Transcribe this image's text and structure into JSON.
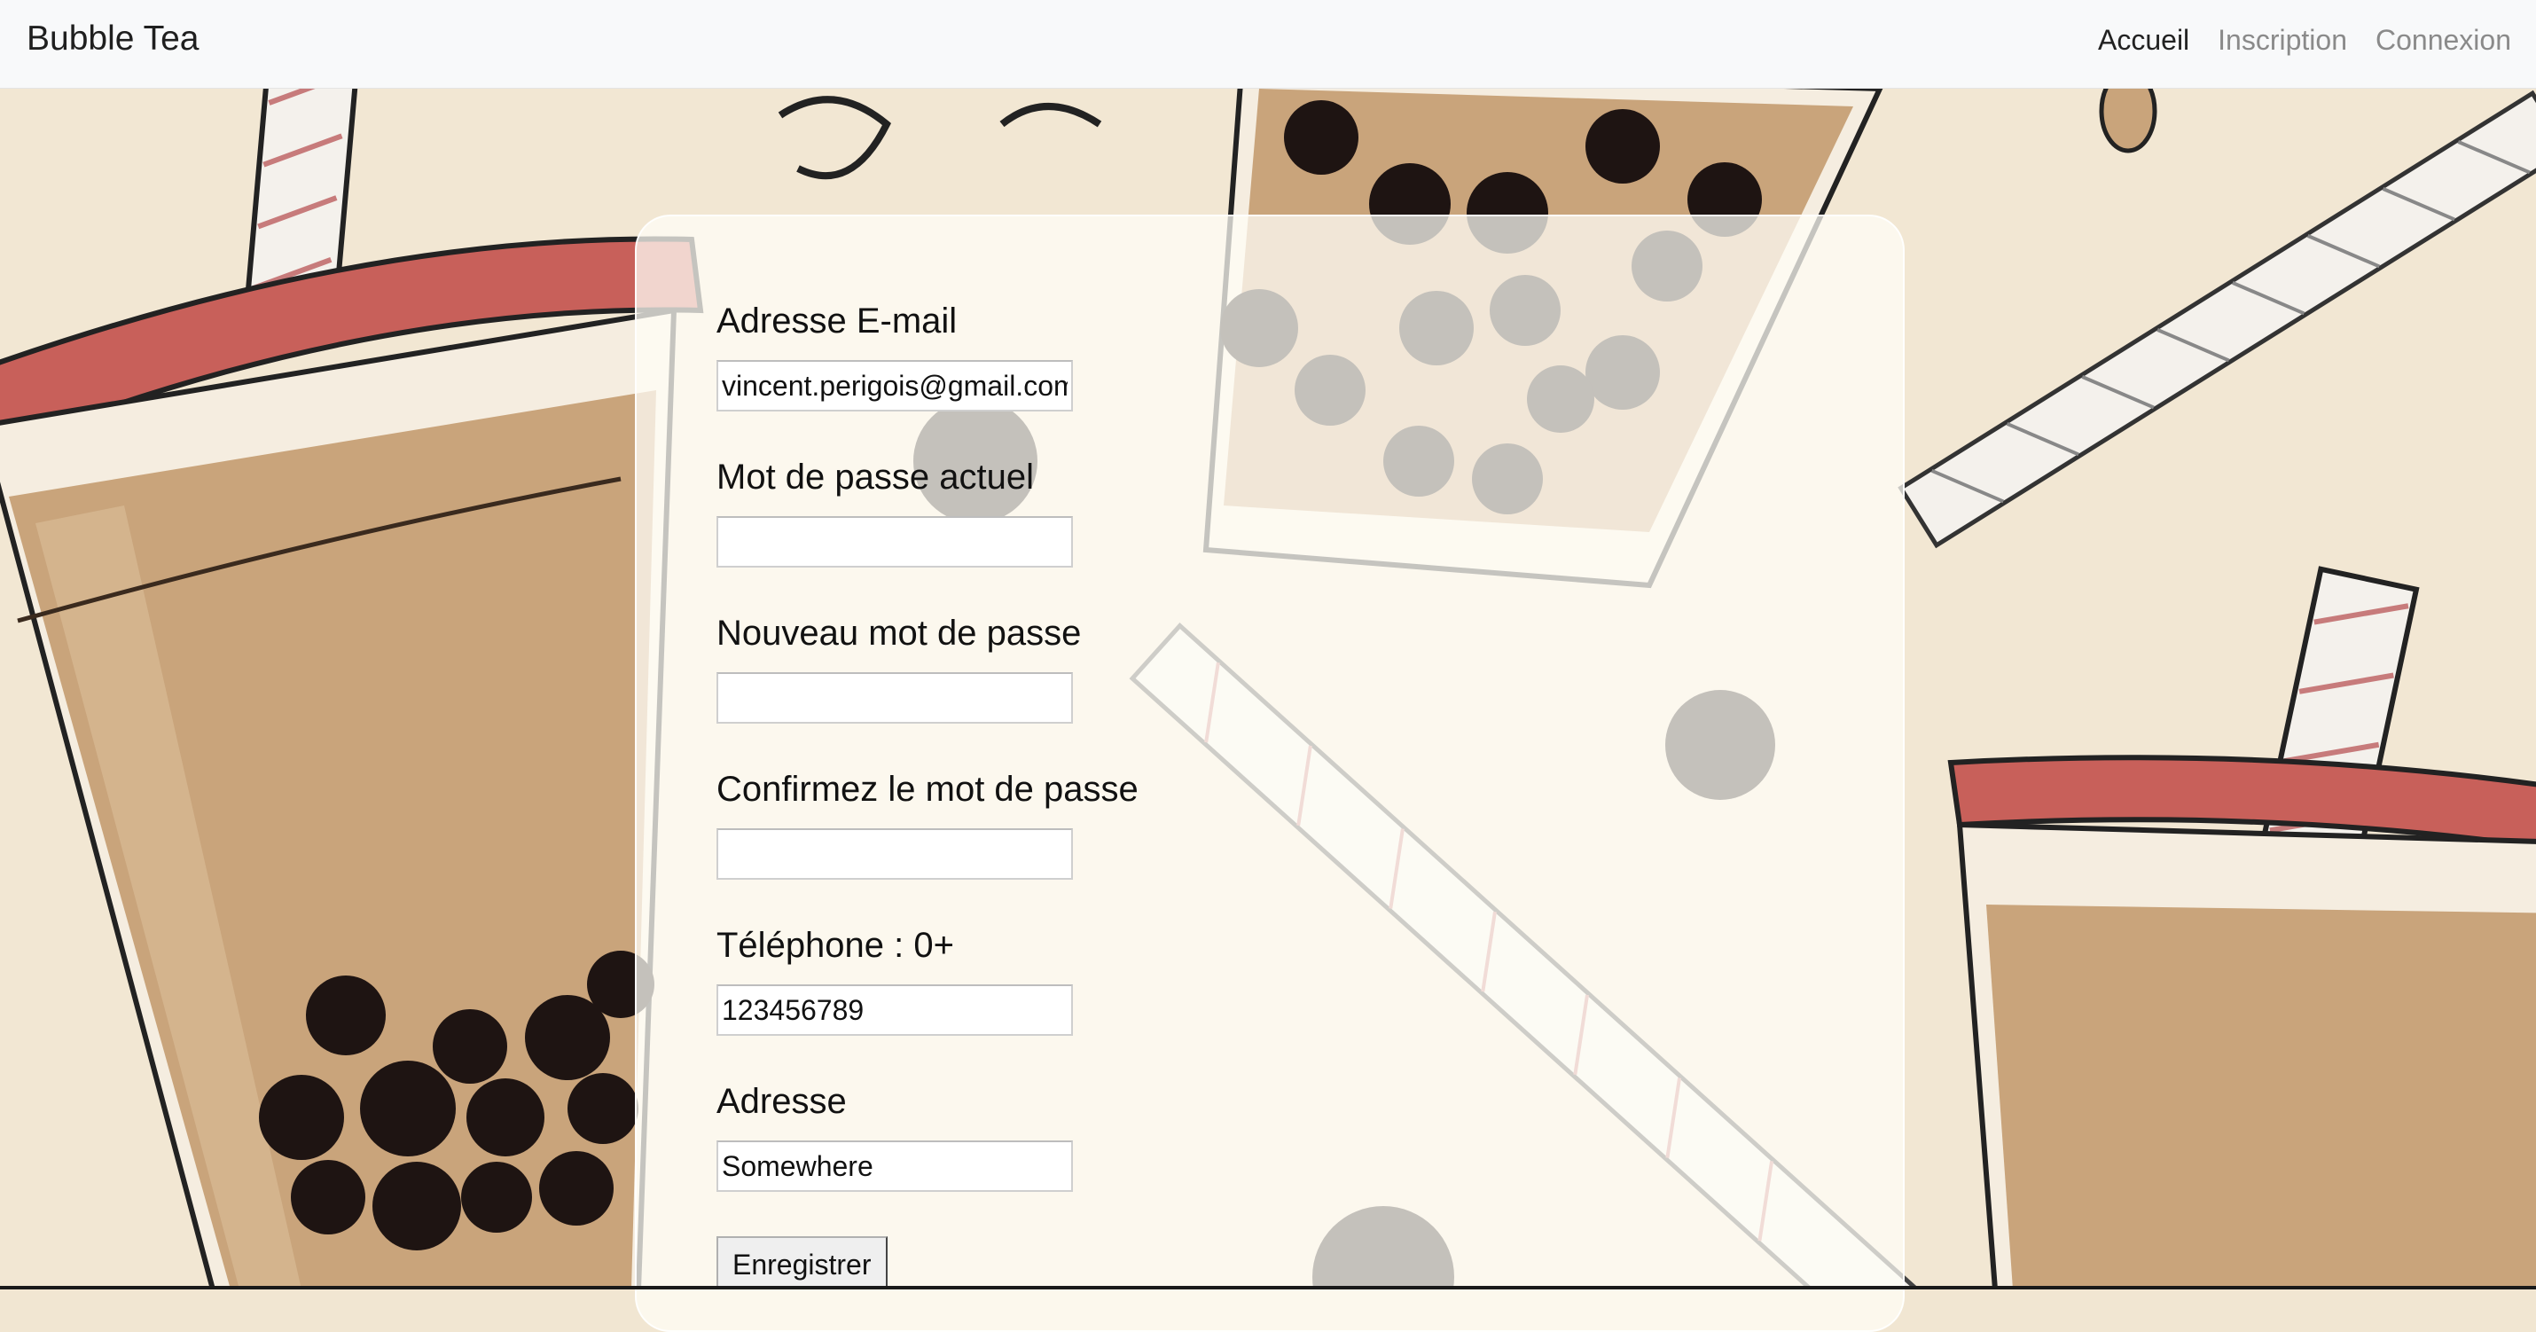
{
  "navbar": {
    "brand": "Bubble Tea",
    "links": [
      {
        "label": "Accueil",
        "active": true
      },
      {
        "label": "Inscription",
        "active": false
      },
      {
        "label": "Connexion",
        "active": false
      }
    ]
  },
  "form": {
    "email": {
      "label": "Adresse E-mail",
      "value": "vincent.perigois@gmail.com"
    },
    "current_password": {
      "label": "Mot de passe actuel",
      "value": ""
    },
    "new_password": {
      "label": "Nouveau mot de passe",
      "value": ""
    },
    "confirm_password": {
      "label": "Confirmez le mot de passe",
      "value": ""
    },
    "phone": {
      "label": "Téléphone : 0+",
      "value": "123456789"
    },
    "address": {
      "label": "Adresse",
      "value": "Somewhere"
    },
    "submit_label": "Enregistrer"
  },
  "colors": {
    "navbar_bg": "#f8f9fa",
    "nav_active": "#222222",
    "nav_inactive": "#8a8a8a",
    "background_cream": "#f1e6d2",
    "tea_brown": "#c9a37a",
    "pearl": "#1e1412",
    "lid_red": "#c5645d"
  },
  "icons": [
    "bubble-tea-cup-illustration",
    "straw-illustration",
    "tapioca-pearl-illustration"
  ]
}
